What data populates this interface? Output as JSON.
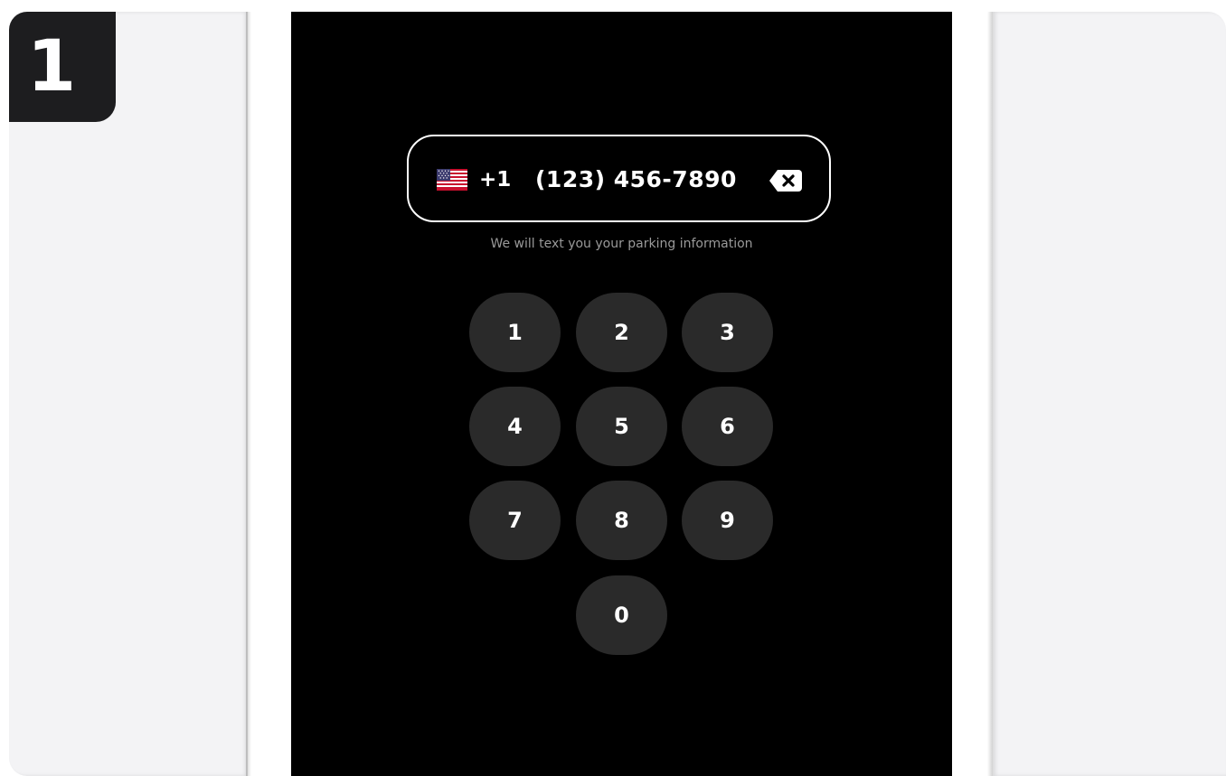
{
  "step": {
    "number": "1"
  },
  "phone_input": {
    "country_flag": "us-flag-icon",
    "country_code": "+1",
    "number": "(123) 456-7890",
    "backspace_icon": "backspace-icon"
  },
  "helper_text": "We will text you your parking information",
  "keypad": {
    "keys": [
      "1",
      "2",
      "3",
      "4",
      "5",
      "6",
      "7",
      "8",
      "9",
      "0"
    ]
  },
  "colors": {
    "screen_background": "#000000",
    "key_background": "#2a2a2a",
    "side_panel": "#f3f3f5",
    "badge": "#1d1d1f"
  }
}
